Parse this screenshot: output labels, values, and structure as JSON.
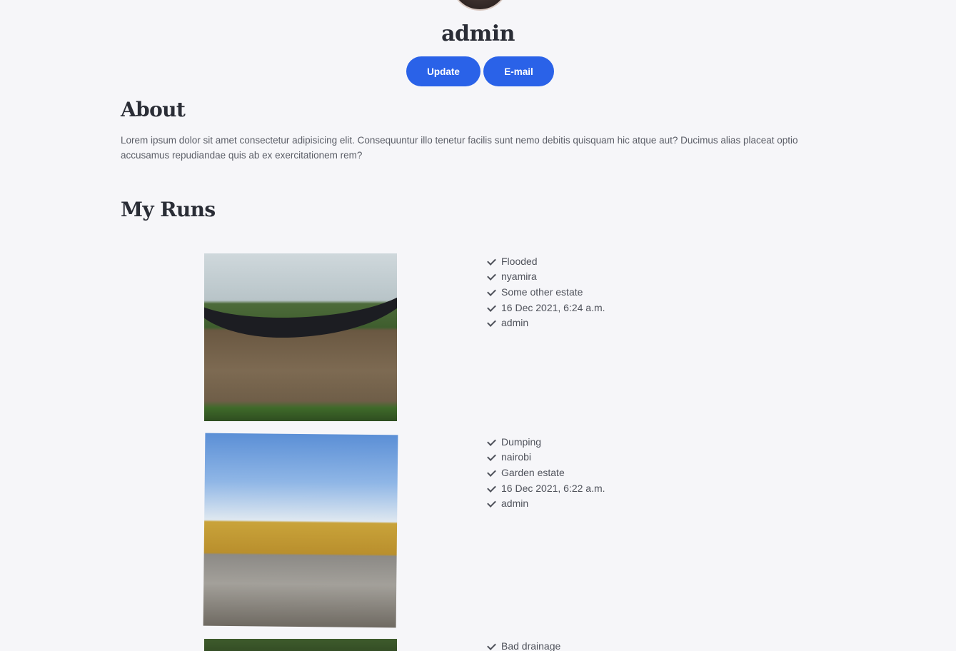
{
  "profile": {
    "name": "admin",
    "update_label": "Update",
    "email_label": "E-mail"
  },
  "about": {
    "title": "About",
    "text": "Lorem ipsum dolor sit amet consectetur adipisicing elit. Consequuntur illo tenetur facilis sunt nemo debitis quisquam hic atque aut? Ducimus alias placeat optio accusamus repudiandae quis ab ex exercitationem rem?"
  },
  "runs": {
    "title": "My Runs",
    "items": [
      {
        "details": [
          "Flooded",
          "nyamira",
          "Some other estate",
          "16 Dec 2021, 6:24 a.m.",
          "admin"
        ]
      },
      {
        "details": [
          "Dumping",
          "nairobi",
          "Garden estate",
          "16 Dec 2021, 6:22 a.m.",
          "admin"
        ]
      },
      {
        "details": [
          "Bad drainage"
        ]
      }
    ]
  },
  "colors": {
    "accent": "#2a62e8",
    "background": "#f6f6f9",
    "heading": "#2a2d36"
  }
}
